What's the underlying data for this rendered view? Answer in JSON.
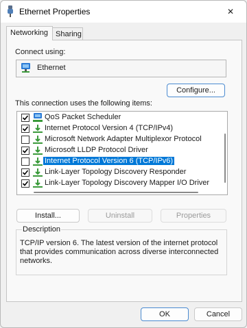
{
  "window": {
    "title": "Ethernet Properties",
    "close_glyph": "✕"
  },
  "tabs": [
    {
      "label": "Networking",
      "active": true
    },
    {
      "label": "Sharing",
      "active": false
    }
  ],
  "connect_using": {
    "label": "Connect using:",
    "adapter": "Ethernet",
    "adapter_icon": "network-adapter-icon"
  },
  "configure_button": "Configure...",
  "items_label": "This connection uses the following items:",
  "items": [
    {
      "label": "QoS Packet Scheduler",
      "checked": true,
      "icon": "qos-icon",
      "selected": false
    },
    {
      "label": "Internet Protocol Version 4 (TCP/IPv4)",
      "checked": true,
      "icon": "protocol-icon",
      "selected": false
    },
    {
      "label": "Microsoft Network Adapter Multiplexor Protocol",
      "checked": false,
      "icon": "protocol-icon",
      "selected": false
    },
    {
      "label": "Microsoft LLDP Protocol Driver",
      "checked": true,
      "icon": "protocol-icon",
      "selected": false
    },
    {
      "label": "Internet Protocol Version 6 (TCP/IPv6)",
      "checked": false,
      "icon": "protocol-icon",
      "selected": true
    },
    {
      "label": "Link-Layer Topology Discovery Responder",
      "checked": true,
      "icon": "protocol-icon",
      "selected": false
    },
    {
      "label": "Link-Layer Topology Discovery Mapper I/O Driver",
      "checked": true,
      "icon": "protocol-icon",
      "selected": false
    }
  ],
  "buttons": {
    "install": "Install...",
    "uninstall": "Uninstall",
    "properties": "Properties",
    "ok": "OK",
    "cancel": "Cancel"
  },
  "description": {
    "legend": "Description",
    "text": "TCP/IP version 6. The latest version of the internet protocol that provides communication across diverse interconnected networks."
  },
  "colors": {
    "selection": "#0078d7",
    "protocol_icon": "#3a9a3a",
    "adapter_icon": "#2b7bd6"
  }
}
